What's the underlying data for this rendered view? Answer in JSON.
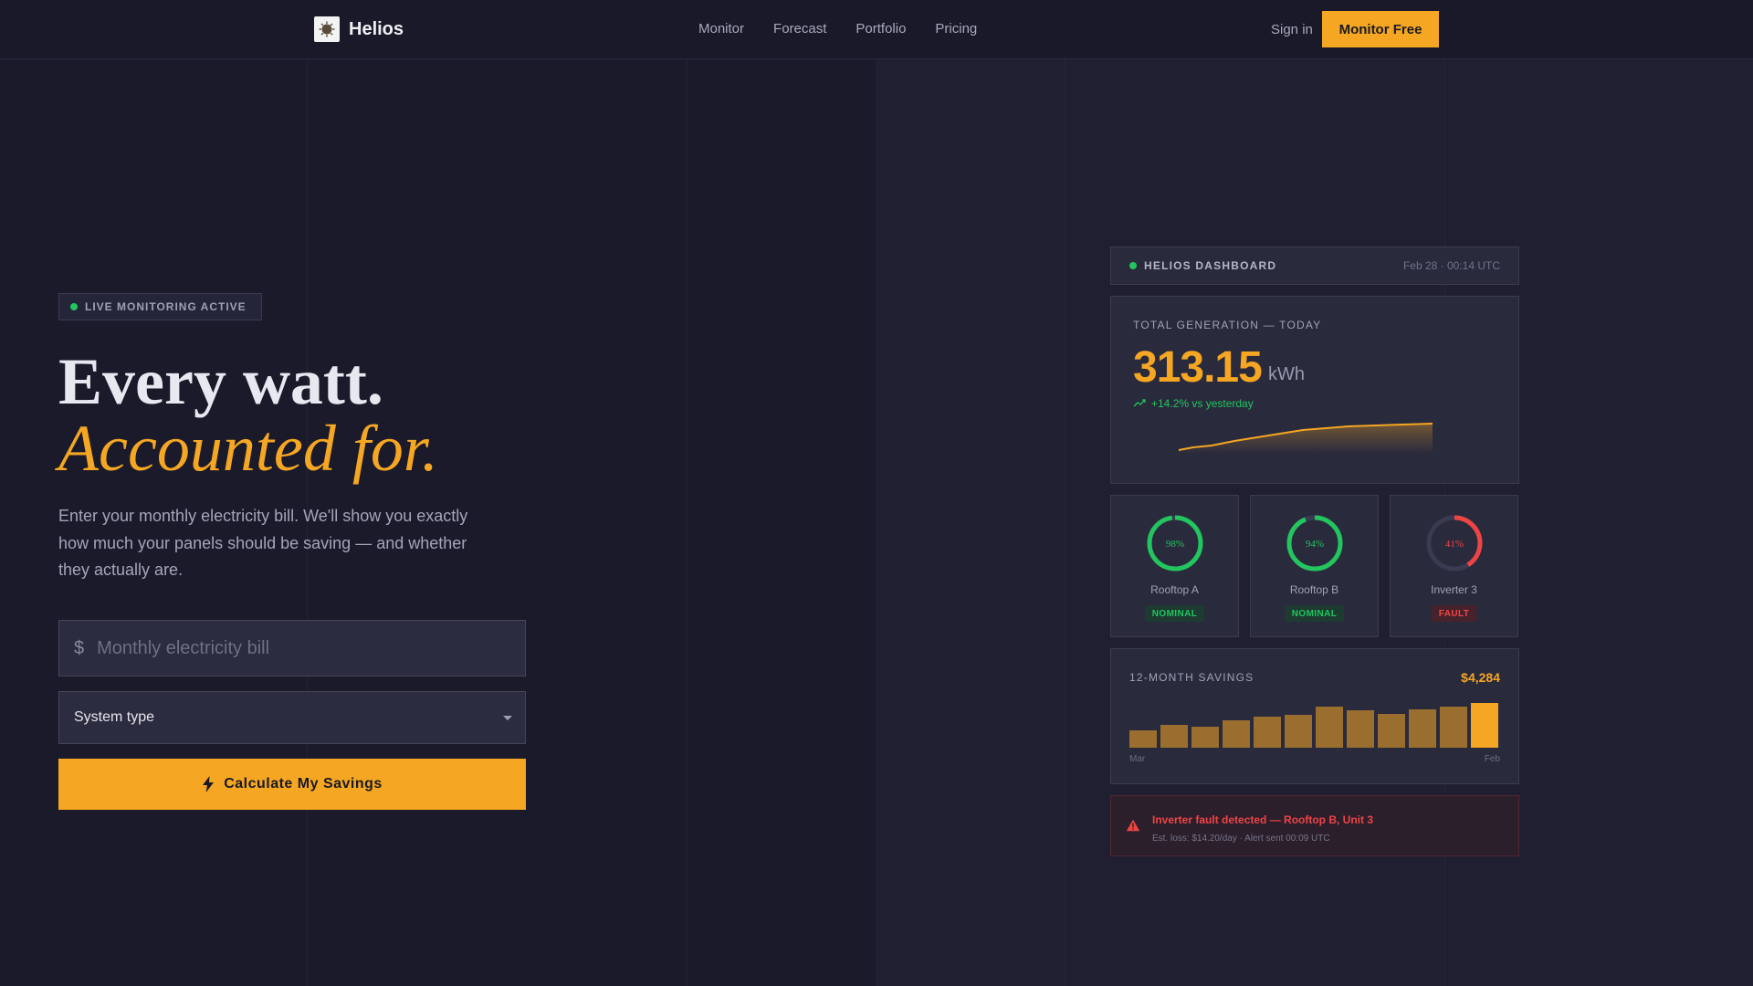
{
  "nav": {
    "brand": "Helios",
    "links": [
      "Monitor",
      "Forecast",
      "Portfolio",
      "Pricing"
    ],
    "sign_in": "Sign in",
    "cta": "Monitor Free"
  },
  "hero": {
    "badge": "LIVE MONITORING ACTIVE",
    "headline_line1": "Every watt.",
    "headline_line2": "Accounted for.",
    "lead": "Enter your monthly electricity bill. We'll show you exactly how much your panels should be saving — and whether they actually are.",
    "currency_symbol": "$",
    "bill_placeholder": "Monthly electricity bill",
    "system_type_label": "System type",
    "calculate_label": "Calculate My Savings"
  },
  "dashboard": {
    "title": "HELIOS DASHBOARD",
    "timestamp": "Feb 28 · 00:14 UTC",
    "generation": {
      "label": "TOTAL GENERATION — TODAY",
      "value": "313.15",
      "unit": "kWh",
      "delta": "+14.2% vs yesterday"
    },
    "units": [
      {
        "name": "Rooftop A",
        "percent": "98%",
        "fraction": 0.98,
        "status": "NOMINAL",
        "color": "#22c55e"
      },
      {
        "name": "Rooftop B",
        "percent": "94%",
        "fraction": 0.94,
        "status": "NOMINAL",
        "color": "#22c55e"
      },
      {
        "name": "Inverter 3",
        "percent": "41%",
        "fraction": 0.41,
        "status": "FAULT",
        "color": "#ef4444"
      }
    ],
    "savings": {
      "label": "12-MONTH SAVINGS",
      "total": "$4,284",
      "start_month": "Mar",
      "end_month": "Feb"
    },
    "alert": {
      "title": "Inverter fault detected — Rooftop B, Unit 3",
      "detail": "Est. loss: $14.20/day · Alert sent 00:09 UTC"
    }
  },
  "colors": {
    "accent": "#f5a623",
    "ok": "#22c55e",
    "fault": "#ef4444",
    "background": "#1a1a2b"
  }
}
